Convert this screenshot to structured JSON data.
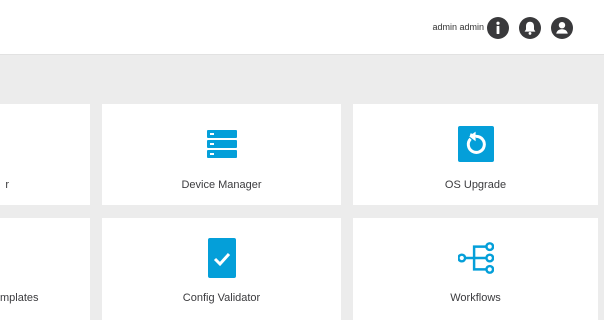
{
  "header": {
    "user_name": "admin admin",
    "icons": [
      "info-icon",
      "bell-icon",
      "user-account-icon"
    ]
  },
  "tiles": [
    {
      "label": "r",
      "icon": "hidden"
    },
    {
      "label": "Device Manager",
      "icon": "server-icon"
    },
    {
      "label": "OS Upgrade",
      "icon": "upgrade-refresh-icon"
    },
    {
      "label": "mplates",
      "icon": "hidden"
    },
    {
      "label": "Config Validator",
      "icon": "clipboard-check-icon"
    },
    {
      "label": "Workflows",
      "icon": "workflow-icon"
    }
  ],
  "colors": {
    "accent": "#049fd9",
    "icon_dark": "#39393b",
    "background": "#ececec",
    "tile": "#ffffff"
  }
}
